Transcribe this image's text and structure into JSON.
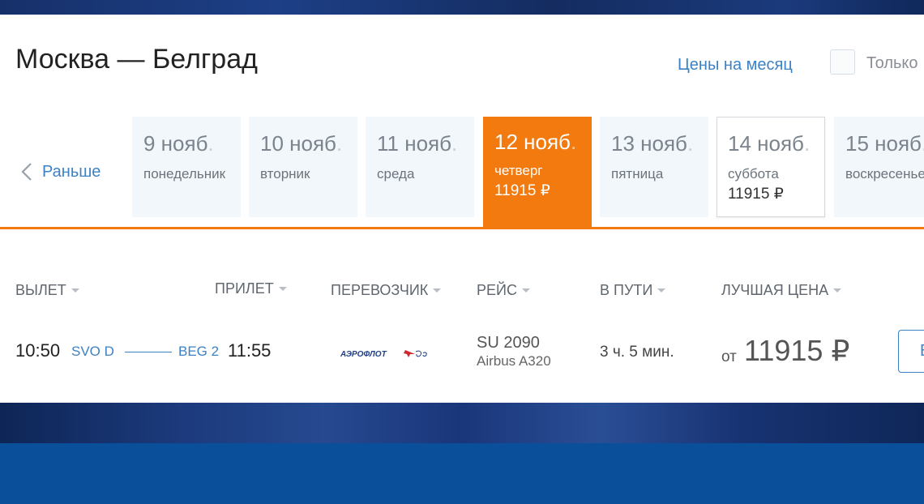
{
  "header": {
    "title": "Москва — Белград",
    "month_prices_link": "Цены на месяц",
    "only_label": "Только"
  },
  "date_nav": {
    "earlier_label": "Раньше",
    "days": [
      {
        "date": "9 нояб",
        "weekday": "понедельник",
        "price": ""
      },
      {
        "date": "10 нояб",
        "weekday": "вторник",
        "price": ""
      },
      {
        "date": "11 нояб",
        "weekday": "среда",
        "price": ""
      },
      {
        "date": "12 нояб",
        "weekday": "четверг",
        "price": "11915 ₽"
      },
      {
        "date": "13 нояб",
        "weekday": "пятница",
        "price": ""
      },
      {
        "date": "14 нояб",
        "weekday": "суббота",
        "price": "11915 ₽"
      },
      {
        "date": "15 нояб",
        "weekday": "воскресенье",
        "price": ""
      }
    ],
    "active_index": 3,
    "date_suffix": "."
  },
  "columns": {
    "departure": "ВЫЛЕТ",
    "arrival": "ПРИЛЕТ",
    "carrier": "ПЕРЕВОЗЧИК",
    "flight": "РЕЙС",
    "duration": "В ПУТИ",
    "best_price": "ЛУЧШАЯ ЦЕНА"
  },
  "flight": {
    "dep_time": "10:50",
    "dep_airport": "SVO D",
    "arr_airport": "BEG 2",
    "arr_time": "11:55",
    "carrier_logo_text": "АЭРОФЛОТ",
    "flight_number": "SU 2090",
    "aircraft": "Airbus A320",
    "duration": "3 ч. 5 мин.",
    "price_prefix": "от",
    "price": "11915 ₽",
    "buy_label": "В"
  },
  "colors": {
    "accent": "#f27a0e",
    "link": "#3d82c4",
    "tab_bg": "#f2f7fc"
  }
}
